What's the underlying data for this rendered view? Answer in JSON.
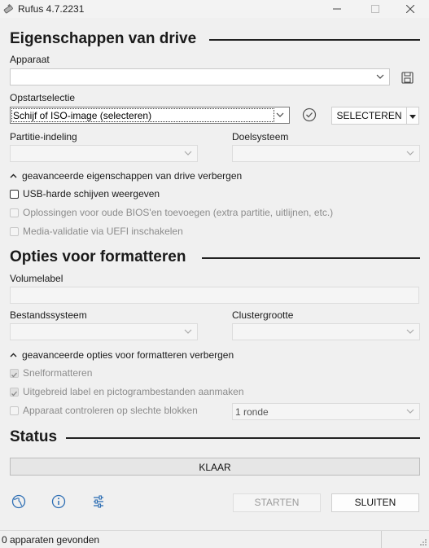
{
  "window": {
    "title": "Rufus 4.7.2231"
  },
  "drive_properties": {
    "heading": "Eigenschappen van drive",
    "device_label": "Apparaat",
    "device_value": "",
    "boot_selection_label": "Opstartselectie",
    "boot_selection_value": "Schijf of ISO-image (selecteren)",
    "select_button": "SELECTEREN",
    "partition_scheme_label": "Partitie-indeling",
    "partition_scheme_value": "",
    "target_system_label": "Doelsysteem",
    "target_system_value": "",
    "advanced_toggle": "geavanceerde eigenschappen van drive verbergen",
    "options": [
      {
        "label": "USB-harde schijven weergeven",
        "checked": false,
        "enabled": true
      },
      {
        "label": "Oplossingen voor oude BIOS'en toevoegen (extra partitie, uitlijnen, etc.)",
        "checked": false,
        "enabled": false
      },
      {
        "label": "Media-validatie via UEFI inschakelen",
        "checked": false,
        "enabled": false
      }
    ]
  },
  "format_options": {
    "heading": "Opties voor formatteren",
    "volume_label_label": "Volumelabel",
    "volume_label_value": "",
    "file_system_label": "Bestandssysteem",
    "file_system_value": "",
    "cluster_size_label": "Clustergrootte",
    "cluster_size_value": "",
    "advanced_toggle": "geavanceerde opties voor formatteren verbergen",
    "options": [
      {
        "label": "Snelformatteren",
        "checked": true,
        "enabled": false
      },
      {
        "label": "Uitgebreid label en pictogrambestanden aanmaken",
        "checked": true,
        "enabled": false
      },
      {
        "label": "Apparaat controleren op slechte blokken",
        "checked": false,
        "enabled": false
      }
    ],
    "passes_value": "1 ronde"
  },
  "status": {
    "heading": "Status",
    "progress_text": "KLAAR",
    "progress": 0
  },
  "actions": {
    "start": "STARTEN",
    "close": "SLUITEN"
  },
  "statusbar": {
    "text": "0 apparaten gevonden"
  },
  "icons": {
    "app": "usb-drive-icon",
    "save": "save-icon",
    "check": "check-circle-icon",
    "language": "globe-icon",
    "about": "info-icon",
    "settings": "settings-sliders-icon"
  }
}
